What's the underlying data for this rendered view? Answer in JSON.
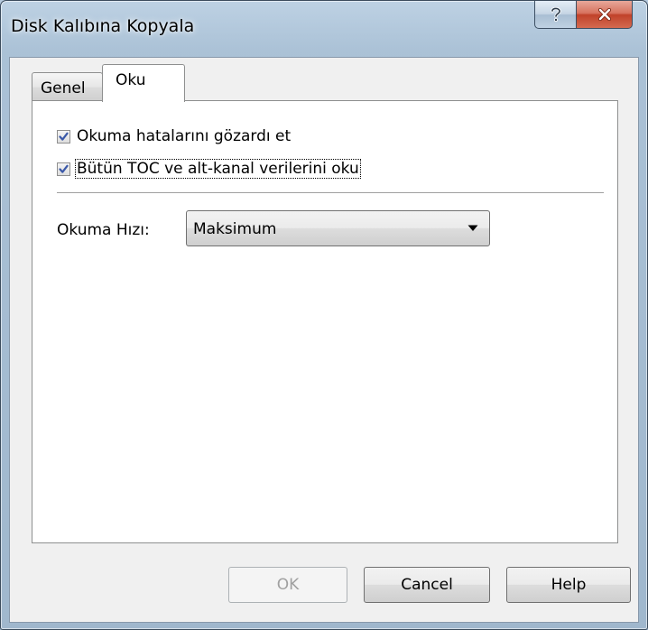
{
  "window": {
    "title": "Disk Kalıbına Kopyala",
    "help_glyph": "?",
    "close_glyph": "x"
  },
  "tabs": [
    {
      "label": "Genel",
      "selected": false
    },
    {
      "label": "Oku",
      "selected": true
    }
  ],
  "oku_tab": {
    "options": [
      {
        "label": "Okuma hatalarını gözardı et",
        "checked": true
      },
      {
        "label": "Bütün TOC ve alt-kanal verilerini oku",
        "checked": true
      }
    ],
    "speed": {
      "label": "Okuma Hızı:",
      "selected": "Maksimum"
    }
  },
  "buttons": {
    "ok": "OK",
    "cancel": "Cancel",
    "help": "Help"
  },
  "colors": {
    "check_mark": "#3a58a8",
    "close_button": "#c0422a"
  }
}
